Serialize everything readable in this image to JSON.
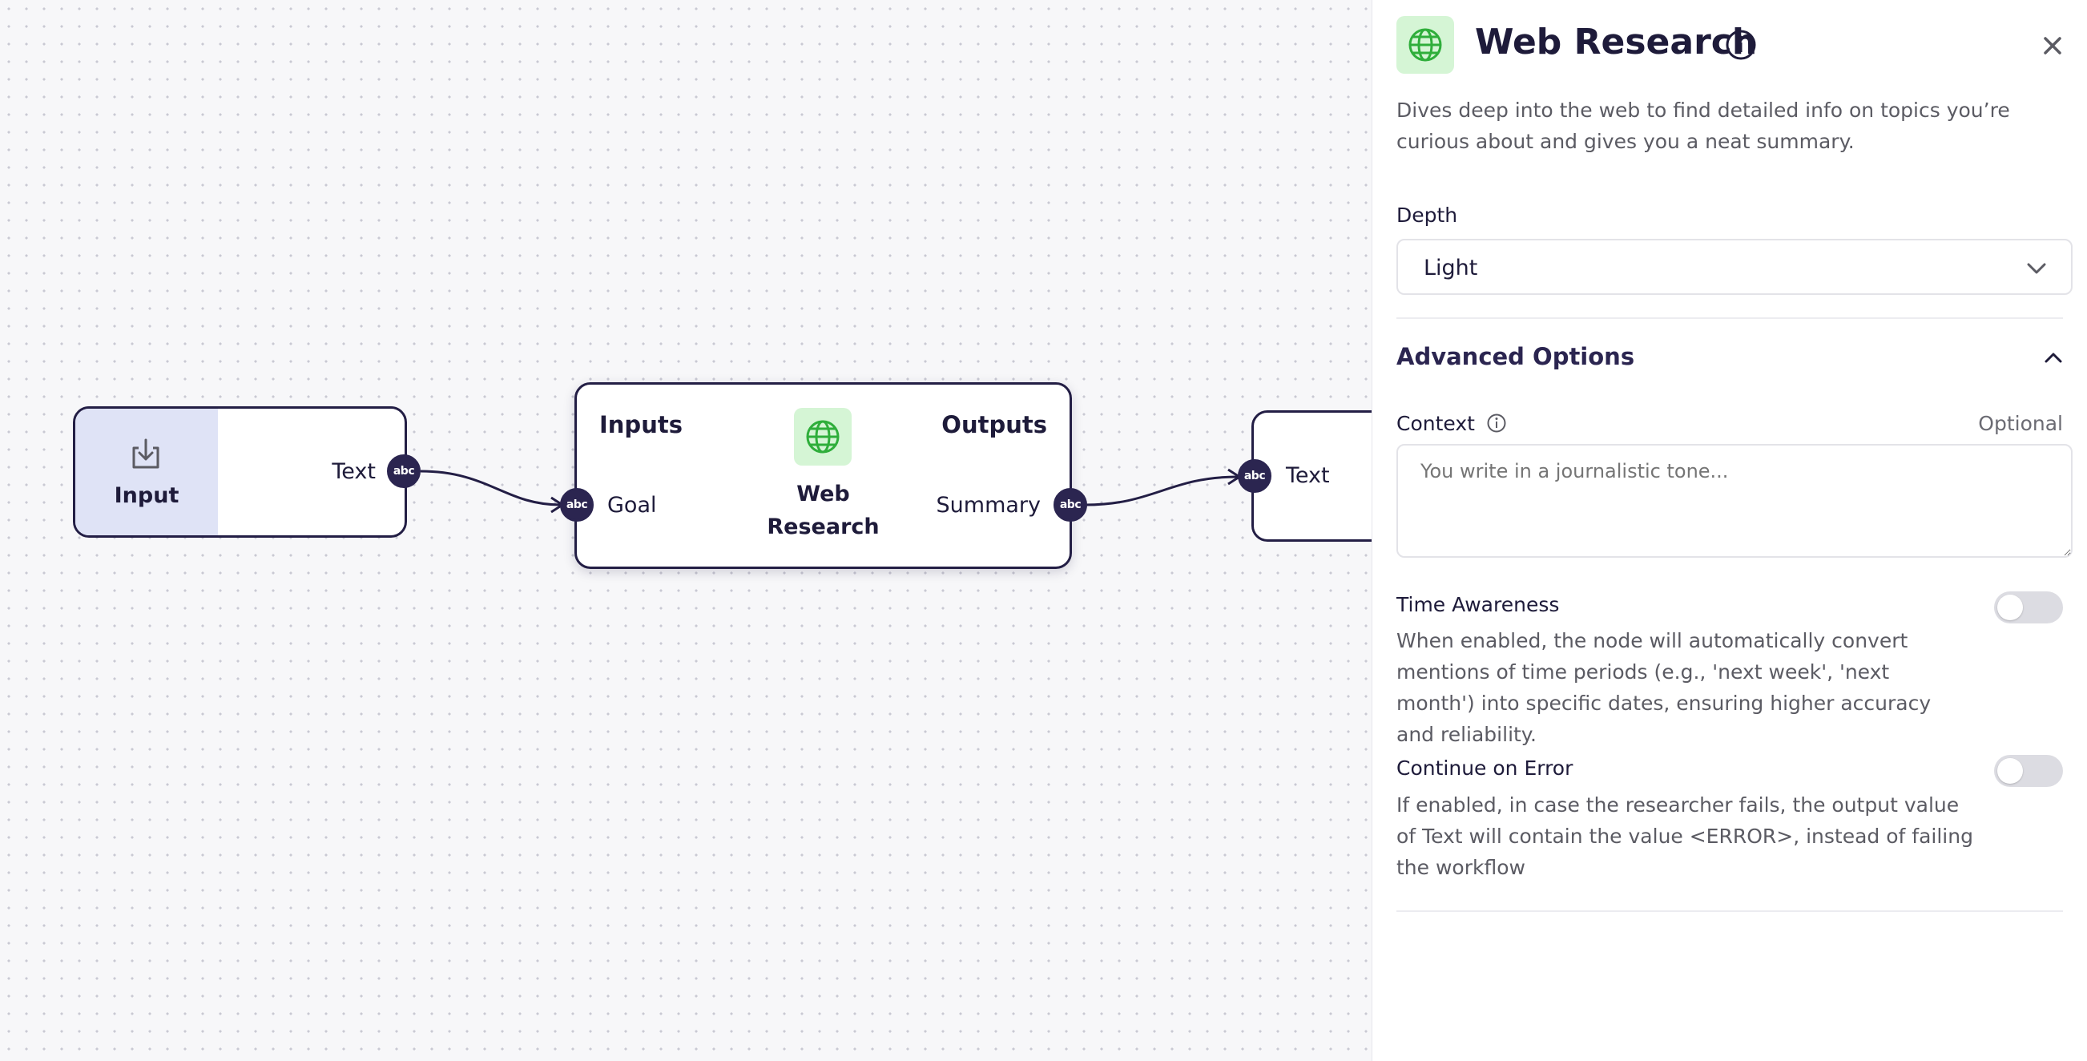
{
  "canvas": {
    "input_node": {
      "title": "Input",
      "output_label": "Text",
      "handle": "abc"
    },
    "research_node": {
      "inputs_header": "Inputs",
      "outputs_header": "Outputs",
      "title_line1": "Web",
      "title_line2": "Research",
      "input_label": "Goal",
      "output_label": "Summary",
      "handle": "abc"
    },
    "output_node": {
      "input_label": "Text",
      "handle": "abc"
    }
  },
  "panel": {
    "title": "Web Research",
    "icon": "globe-icon",
    "description": "Dives deep into the web to find detailed info on topics you’re curious about and gives you a neat summary.",
    "depth": {
      "label": "Depth",
      "value": "Light"
    },
    "advanced": {
      "label": "Advanced Options"
    },
    "context": {
      "label": "Context",
      "optional": "Optional",
      "placeholder": "You write in a journalistic tone..."
    },
    "time_awareness": {
      "label": "Time Awareness",
      "description": "When enabled, the node will automatically convert mentions of time periods (e.g., 'next week', 'next month') into specific dates, ensuring higher accuracy and reliability.",
      "enabled": false
    },
    "continue_on_error": {
      "label": "Continue on Error",
      "description": "If enabled, in case the researcher fails, the output value of Text will contain the value <ERROR>, instead of failing the workflow",
      "enabled": false
    }
  },
  "colors": {
    "accent": "#231e45",
    "icon_green": "#2fae3b",
    "input_node_bg": "#dfe3f6"
  }
}
